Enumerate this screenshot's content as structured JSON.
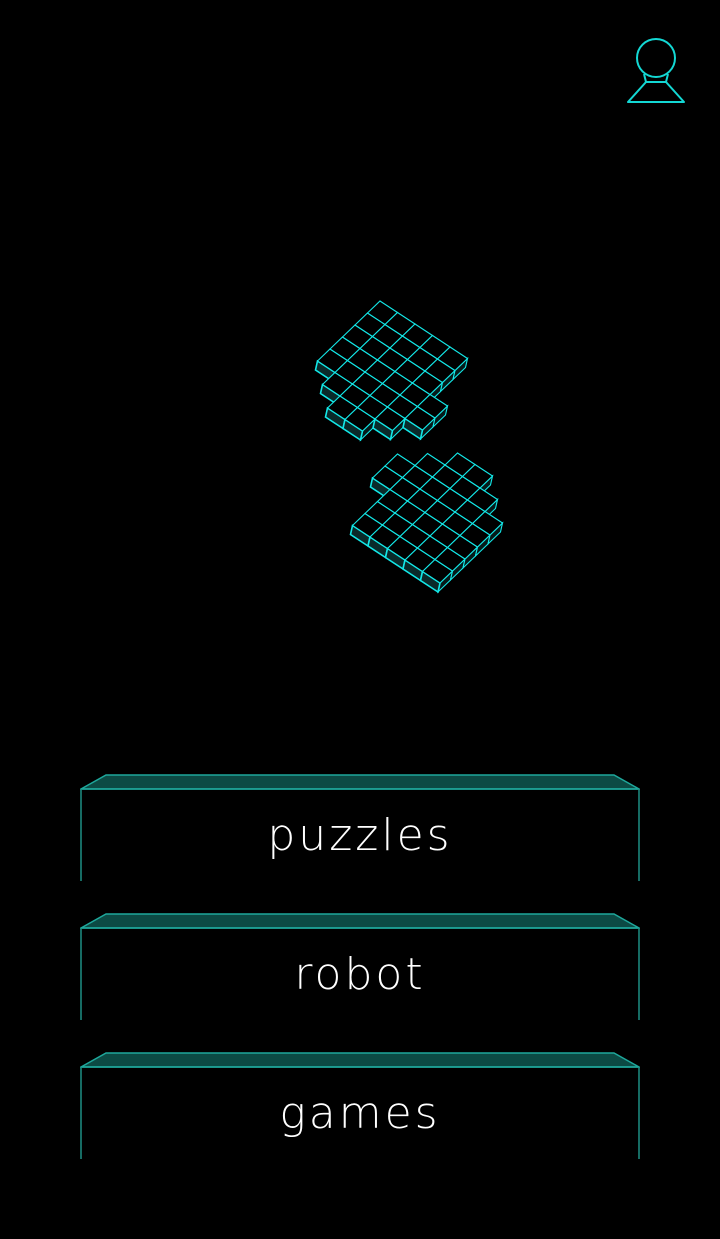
{
  "colors": {
    "background": "#000000",
    "accent": "#13e8e8",
    "accent_dim": "#1e8f84",
    "bevel_fill": "#0c4a44",
    "label": "#ffffff"
  },
  "header": {
    "profile_icon": "user-profile-icon"
  },
  "logo": {
    "icon": "voxel-cube-logo"
  },
  "menu": {
    "items": [
      {
        "label": "puzzles"
      },
      {
        "label": "robot"
      },
      {
        "label": "games"
      }
    ]
  }
}
